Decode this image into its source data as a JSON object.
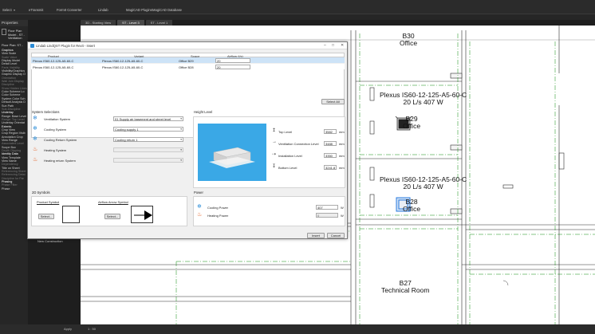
{
  "ribbon": {
    "select": "Select",
    "items": [
      "eTransmit",
      "FormIt Converter",
      "Lindab",
      "MagiCAD Plugins",
      "MagiCAD Database"
    ]
  },
  "tabs": [
    "3D - Starting View",
    "ST - Level 3",
    "ST - Level 1"
  ],
  "properties": {
    "title": "Properties",
    "floor_plan": "Floor Plan",
    "model": "Model - ST - Ventilation",
    "selector": "Floor Plan: ST -",
    "items": [
      {
        "t": "Graphics",
        "k": "grp"
      },
      {
        "t": "View Scale",
        "k": ""
      },
      {
        "t": "Scale Value",
        "k": "dim"
      },
      {
        "t": "Display Model",
        "k": ""
      },
      {
        "t": "Detail Level",
        "k": ""
      },
      {
        "t": "Parts Visibility",
        "k": "dim"
      },
      {
        "t": "Visibility/Graphics",
        "k": ""
      },
      {
        "t": "Graphic Display O",
        "k": ""
      },
      {
        "t": "Orientation",
        "k": "dim"
      },
      {
        "t": "Wall Join Display",
        "k": "dim"
      },
      {
        "t": "Discipline",
        "k": "dim"
      },
      {
        "t": "Show Hidden Lines",
        "k": "dim"
      },
      {
        "t": "Color Scheme Lo",
        "k": ""
      },
      {
        "t": "Color Scheme",
        "k": ""
      },
      {
        "t": "System Color Sch",
        "k": ""
      },
      {
        "t": "Default Analysis D",
        "k": ""
      },
      {
        "t": "Sun Path",
        "k": ""
      },
      {
        "t": "Sub-Discipline",
        "k": "dim"
      },
      {
        "t": "Underlay",
        "k": "grp"
      },
      {
        "t": "Range: Base Level",
        "k": ""
      },
      {
        "t": "Range: Top Level",
        "k": "dim"
      },
      {
        "t": "Underlay Orientat",
        "k": ""
      },
      {
        "t": "Extents",
        "k": "grp"
      },
      {
        "t": "Crop View",
        "k": ""
      },
      {
        "t": "Crop Region Visib",
        "k": ""
      },
      {
        "t": "Annotation Crop",
        "k": ""
      },
      {
        "t": "View Range",
        "k": ""
      },
      {
        "t": "Associated Level",
        "k": "dim"
      },
      {
        "t": "Scope Box",
        "k": ""
      },
      {
        "t": "Depth Clipping",
        "k": "dim"
      },
      {
        "t": "Identity Data",
        "k": "grp"
      },
      {
        "t": "View Template",
        "k": ""
      },
      {
        "t": "View Name",
        "k": ""
      },
      {
        "t": "Dependency",
        "k": "dim"
      },
      {
        "t": "Title on Sheet",
        "k": ""
      },
      {
        "t": "Referencing Sheet",
        "k": "dim"
      },
      {
        "t": "Referencing Detai",
        "k": "dim"
      },
      {
        "t": "Discipline for Par",
        "k": "dim"
      },
      {
        "t": "Phasing",
        "k": "grp"
      },
      {
        "t": "Phase Filter",
        "k": "dim"
      },
      {
        "t": "Phase",
        "k": ""
      }
    ]
  },
  "plan": {
    "rooms": [
      {
        "id": "r30",
        "lines": [
          "B30",
          "Office"
        ]
      },
      {
        "id": "r29",
        "lines": [
          "B29",
          "Office"
        ]
      },
      {
        "id": "r28",
        "lines": [
          "B28",
          "Office"
        ]
      },
      {
        "id": "r27",
        "lines": [
          "B27",
          "Technical Room"
        ]
      }
    ],
    "tags": [
      {
        "id": "tag1",
        "lines": [
          "Plexus IS60-12-125-A5-60-C",
          "20 L/s 407 W"
        ]
      },
      {
        "id": "tag2",
        "lines": [
          "Plexus IS60-12-125-A5-60-C",
          "20 L/s 407 W"
        ]
      }
    ],
    "new_construction": "New Construction",
    "apply": "Apply"
  },
  "status": {
    "scale": "1 : 50"
  },
  "dialog": {
    "title": "Lindab LindQST Plugin for Revit - Insert",
    "columns": {
      "product": "Product",
      "variant": "Variant",
      "space": "Space",
      "airflow": "Airflow (l/s)"
    },
    "rows": [
      {
        "product": "Plexus IS60-12-125-A5-60-C",
        "variant": "Plexus IS60-12-125-A5-60-C",
        "space": "Office B29",
        "airflow": "20"
      },
      {
        "product": "Plexus IS60-12-125-A5-60-C",
        "variant": "Plexus IS60-12-125-A5-60-C",
        "space": "Office B28",
        "airflow": "20"
      }
    ],
    "select_all": "Select All",
    "system_selections": {
      "title": "System Selections",
      "rows": [
        {
          "icon": "ventilation-icon",
          "label": "Ventilation System",
          "value": "01 Supply air basement and street level",
          "disabled": false,
          "color": "#3b8fd8"
        },
        {
          "icon": "cooling-icon",
          "label": "Cooling System",
          "value": "Cooling supply 1",
          "disabled": false,
          "color": "#2e8ed8"
        },
        {
          "icon": "cooling-return-icon",
          "label": "Cooling Return System",
          "value": "Cooling return 1",
          "disabled": false,
          "color": "#2e8ed8"
        },
        {
          "icon": "heating-icon",
          "label": "Heating System",
          "value": "",
          "disabled": true,
          "color": "#e35a1c"
        },
        {
          "icon": "heating-return-icon",
          "label": "Heating return System",
          "value": "",
          "disabled": true,
          "color": "#e35a1c"
        }
      ]
    },
    "height_level": {
      "title": "Height Level",
      "rows": [
        {
          "label": "Top Level",
          "value": "3582",
          "unit": "mm"
        },
        {
          "label": "Ventilation Connection Level",
          "value": "3488",
          "unit": "mm"
        },
        {
          "label": "Installation Level",
          "value": "3350",
          "unit": "mm"
        },
        {
          "label": "Bottom Level",
          "value": "3241.8",
          "unit": "mm"
        }
      ]
    },
    "symbols": {
      "title": "2D Symbols",
      "product_symbol": "Product Symbol",
      "airflow_symbol": "Airflow Arrow Symbol",
      "select1": "Select...",
      "select2": "Select..."
    },
    "power": {
      "title": "Power",
      "rows": [
        {
          "label": "Cooling Power",
          "value": "407",
          "unit": "W",
          "disabled": false,
          "color": "#2e8ed8"
        },
        {
          "label": "Heating Power",
          "value": "0",
          "unit": "W",
          "disabled": true,
          "color": "#e35a1c"
        }
      ]
    },
    "insert": "Insert",
    "cancel": "Cancel"
  }
}
